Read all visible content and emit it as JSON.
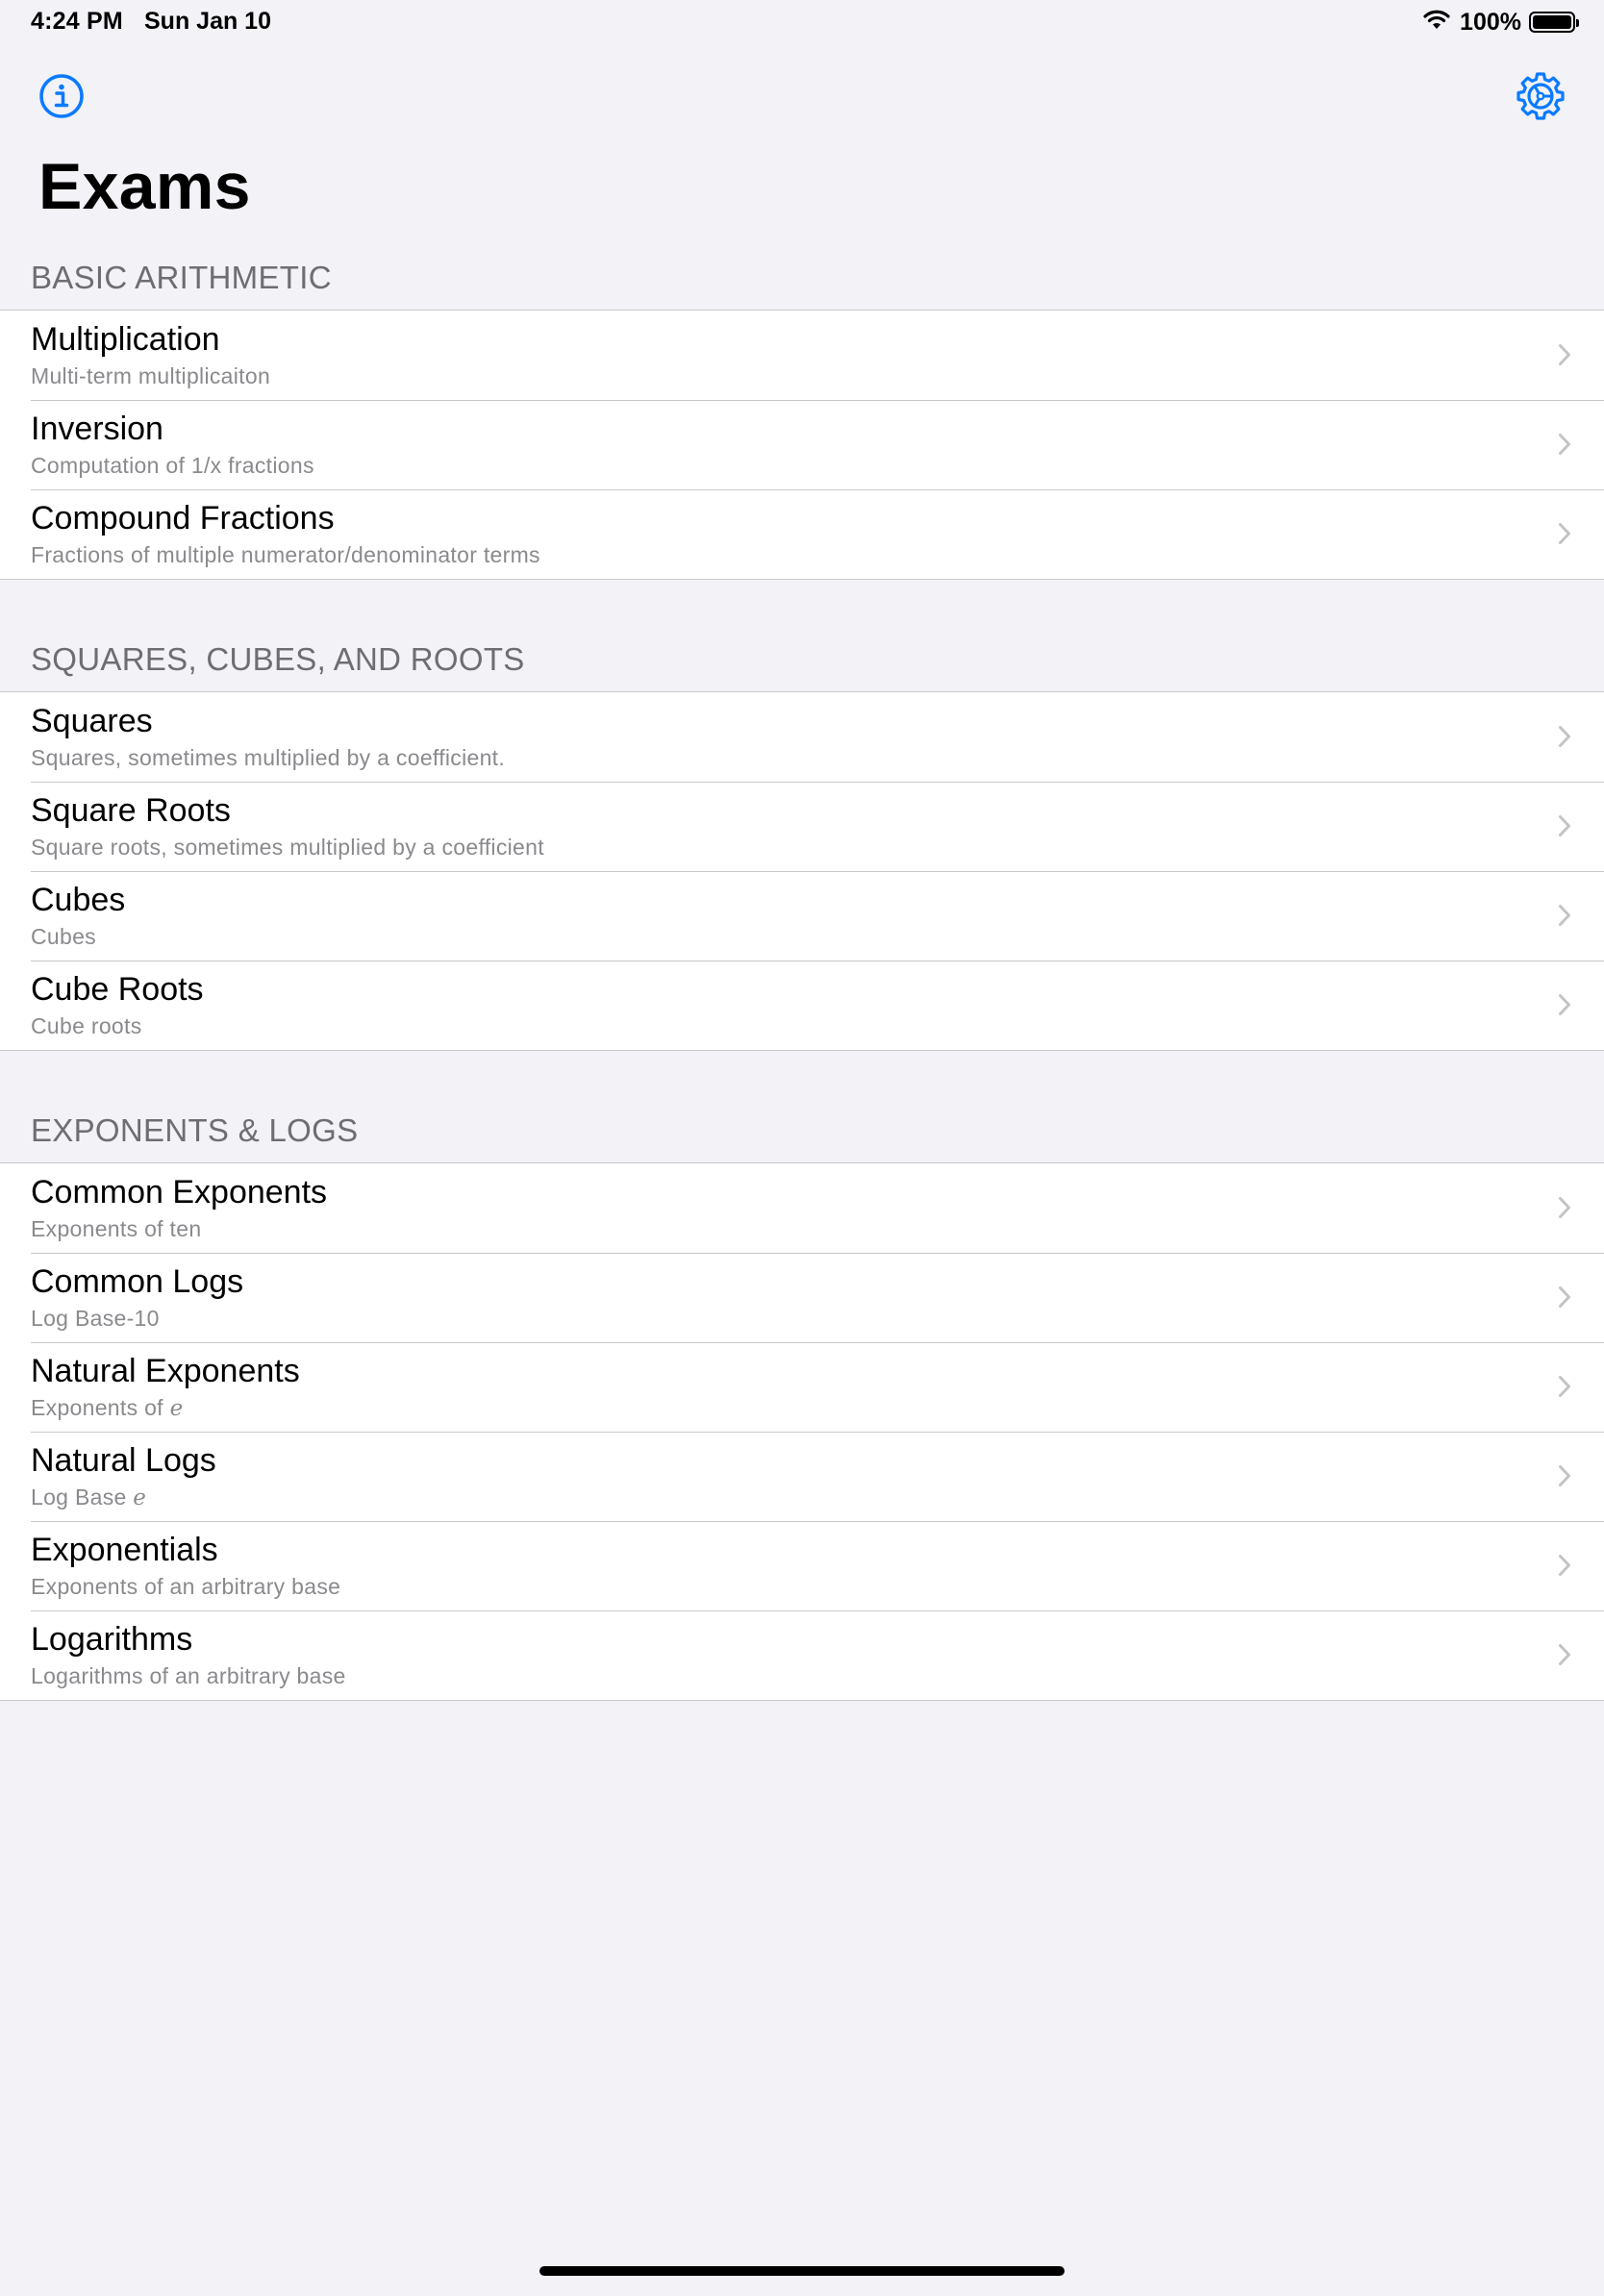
{
  "status_bar": {
    "time": "4:24 PM",
    "date": "Sun Jan 10",
    "battery": "100%",
    "wifi_icon": "wifi-icon",
    "battery_icon": "battery-icon"
  },
  "nav": {
    "info_icon": "info-circle-icon",
    "settings_icon": "gear-icon",
    "title": "Exams",
    "accent_color": "#0A7AFF"
  },
  "sections": [
    {
      "header": "BASIC ARITHMETIC",
      "items": [
        {
          "title": "Multiplication",
          "subtitle": "Multi-term multiplicaiton"
        },
        {
          "title": "Inversion",
          "subtitle": "Computation of 1/x fractions"
        },
        {
          "title": "Compound Fractions",
          "subtitle": "Fractions of multiple numerator/denominator terms"
        }
      ]
    },
    {
      "header": "SQUARES, CUBES, AND ROOTS",
      "items": [
        {
          "title": "Squares",
          "subtitle": "Squares, sometimes multiplied by a coefficient."
        },
        {
          "title": "Square Roots",
          "subtitle": "Square roots, sometimes multiplied by a coefficient"
        },
        {
          "title": "Cubes",
          "subtitle": "Cubes"
        },
        {
          "title": "Cube Roots",
          "subtitle": "Cube roots"
        }
      ]
    },
    {
      "header": "EXPONENTS & LOGS",
      "items": [
        {
          "title": "Common Exponents",
          "subtitle": "Exponents of ten"
        },
        {
          "title": "Common Logs",
          "subtitle": "Log Base-10"
        },
        {
          "title": "Natural Exponents",
          "subtitle": "Exponents of",
          "subtitle_math": "e"
        },
        {
          "title": "Natural Logs",
          "subtitle": "Log Base",
          "subtitle_math": "e"
        },
        {
          "title": "Exponentials",
          "subtitle": "Exponents of an arbitrary base"
        },
        {
          "title": "Logarithms",
          "subtitle": "Logarithms of an arbitrary base"
        }
      ]
    }
  ],
  "chevron_icon": "chevron-right-icon"
}
